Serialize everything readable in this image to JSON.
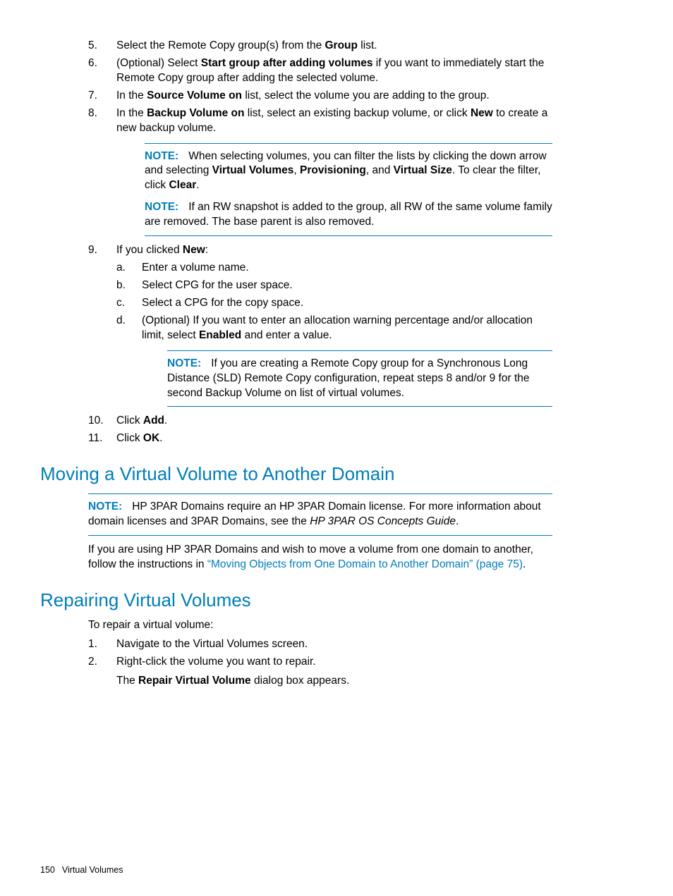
{
  "steps": {
    "s5": {
      "num": "5.",
      "pre": "Select the Remote Copy group(s) from the ",
      "b1": "Group",
      "post": " list."
    },
    "s6": {
      "num": "6.",
      "pre": "(Optional) Select ",
      "b1": "Start group after adding volumes",
      "post": " if you want to immediately start the Remote Copy group after adding the selected volume."
    },
    "s7": {
      "num": "7.",
      "pre": "In the ",
      "b1": "Source Volume on",
      "post": " list, select the volume you are adding to the group."
    },
    "s8": {
      "num": "8.",
      "pre": "In the ",
      "b1": "Backup Volume on",
      "mid": " list, select an existing backup volume, or click ",
      "b2": "New",
      "post": " to create a new backup volume."
    },
    "s9": {
      "num": "9.",
      "pre": "If you clicked ",
      "b1": "New",
      "post": ":"
    },
    "s9a": {
      "snum": "a.",
      "text": "Enter a volume name."
    },
    "s9b": {
      "snum": "b.",
      "text": "Select CPG for the user space."
    },
    "s9c": {
      "snum": "c.",
      "text": "Select a CPG for the copy space."
    },
    "s9d": {
      "snum": "d.",
      "pre": "(Optional) If you want to enter an allocation warning percentage and/or allocation limit, select ",
      "b1": "Enabled",
      "post": " and enter a value."
    },
    "s10": {
      "num": "10.",
      "pre": "Click ",
      "b1": "Add",
      "post": "."
    },
    "s11": {
      "num": "11.",
      "pre": "Click ",
      "b1": "OK",
      "post": "."
    }
  },
  "notes": {
    "label": "NOTE:",
    "n1": {
      "pre": "When selecting volumes, you can filter the lists by clicking the down arrow and selecting ",
      "b1": "Virtual Volumes",
      "c1": ", ",
      "b2": "Provisioning",
      "c2": ", and ",
      "b3": "Virtual Size",
      "c3": ". To clear the filter, click ",
      "b4": "Clear",
      "post": "."
    },
    "n2": "If an RW snapshot is added to the group, all RW of the same volume family are removed. The base parent is also removed.",
    "n3": "If you are creating a Remote Copy group for a Synchronous Long Distance (SLD) Remote Copy configuration, repeat steps 8 and/or 9 for the second Backup Volume on list of virtual volumes.",
    "n4": {
      "pre": "HP 3PAR Domains require an HP 3PAR Domain license. For more information about domain licenses and 3PAR Domains, see the ",
      "i1": "HP 3PAR OS Concepts Guide",
      "post": "."
    }
  },
  "headings": {
    "h1": "Moving a Virtual Volume to Another Domain",
    "h2": "Repairing Virtual Volumes"
  },
  "paras": {
    "p1": {
      "pre": "If you are using HP 3PAR Domains and wish to move a volume from one domain to another, follow the instructions in ",
      "link": "“Moving Objects from One Domain to Another Domain” (page 75)",
      "post": "."
    },
    "p2": "To repair a virtual volume:"
  },
  "repair": {
    "r1": {
      "num": "1.",
      "text": "Navigate to the Virtual Volumes screen."
    },
    "r2": {
      "num": "2.",
      "text": "Right-click the volume you want to repair."
    },
    "r2b": {
      "pre": "The ",
      "b1": "Repair Virtual Volume",
      "post": " dialog box appears."
    }
  },
  "footer": {
    "page": "150",
    "title": "Virtual Volumes"
  }
}
